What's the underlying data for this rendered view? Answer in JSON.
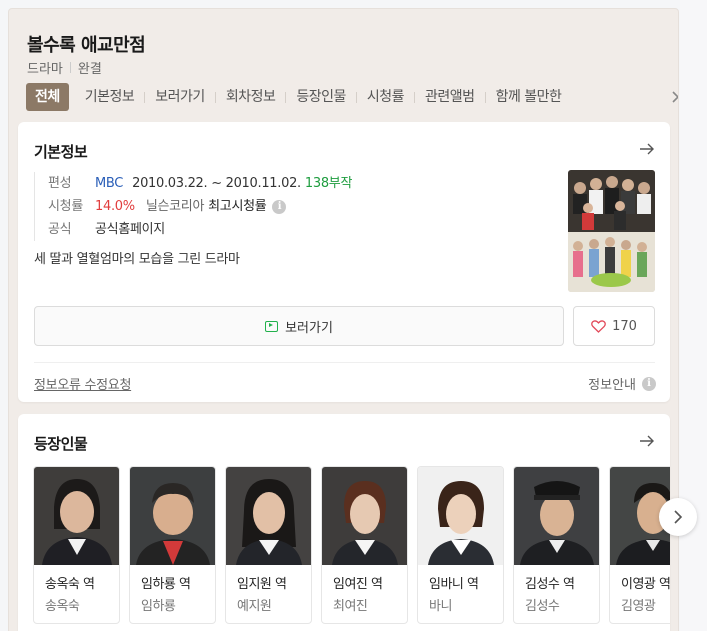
{
  "header": {
    "title": "볼수록 애교만점",
    "genre": "드라마",
    "status": "완결"
  },
  "tabs": [
    {
      "label": "전체",
      "active": true
    },
    {
      "label": "기본정보"
    },
    {
      "label": "보러가기"
    },
    {
      "label": "회차정보"
    },
    {
      "label": "등장인물"
    },
    {
      "label": "시청률"
    },
    {
      "label": "관련앨범"
    },
    {
      "label": "함께 볼만한"
    }
  ],
  "basic_info": {
    "title": "기본정보",
    "schedule_key": "편성",
    "channel": "MBC",
    "period": "2010.03.22. ~ 2010.11.02.",
    "episodes": "138부작",
    "rating_key": "시청률",
    "rating_value": "14.0%",
    "rating_source": "닐슨코리아",
    "rating_label": "최고시청률",
    "official_key": "공식",
    "official_link": "공식홈페이지",
    "description": "세 딸과 열혈엄마의 모습을 그린 드라마",
    "watch_button": "보러가기",
    "like_count": "170",
    "report_link": "정보오류 수정요청",
    "guide_link": "정보안내"
  },
  "cast_section": {
    "title": "등장인물",
    "members": [
      {
        "role": "송옥숙 역",
        "actor": "송옥숙"
      },
      {
        "role": "임하룡 역",
        "actor": "임하룡"
      },
      {
        "role": "임지원 역",
        "actor": "예지원"
      },
      {
        "role": "임여진 역",
        "actor": "최여진"
      },
      {
        "role": "임바니 역",
        "actor": "바니"
      },
      {
        "role": "김성수 역",
        "actor": "김성수"
      },
      {
        "role": "이영광 역",
        "actor": "김영광"
      }
    ]
  },
  "colors": {
    "accent_tab": "#8c7966",
    "rating_red": "#e13d3d",
    "episodes_green": "#1f9d3f",
    "channel_blue": "#2b5fb8"
  }
}
